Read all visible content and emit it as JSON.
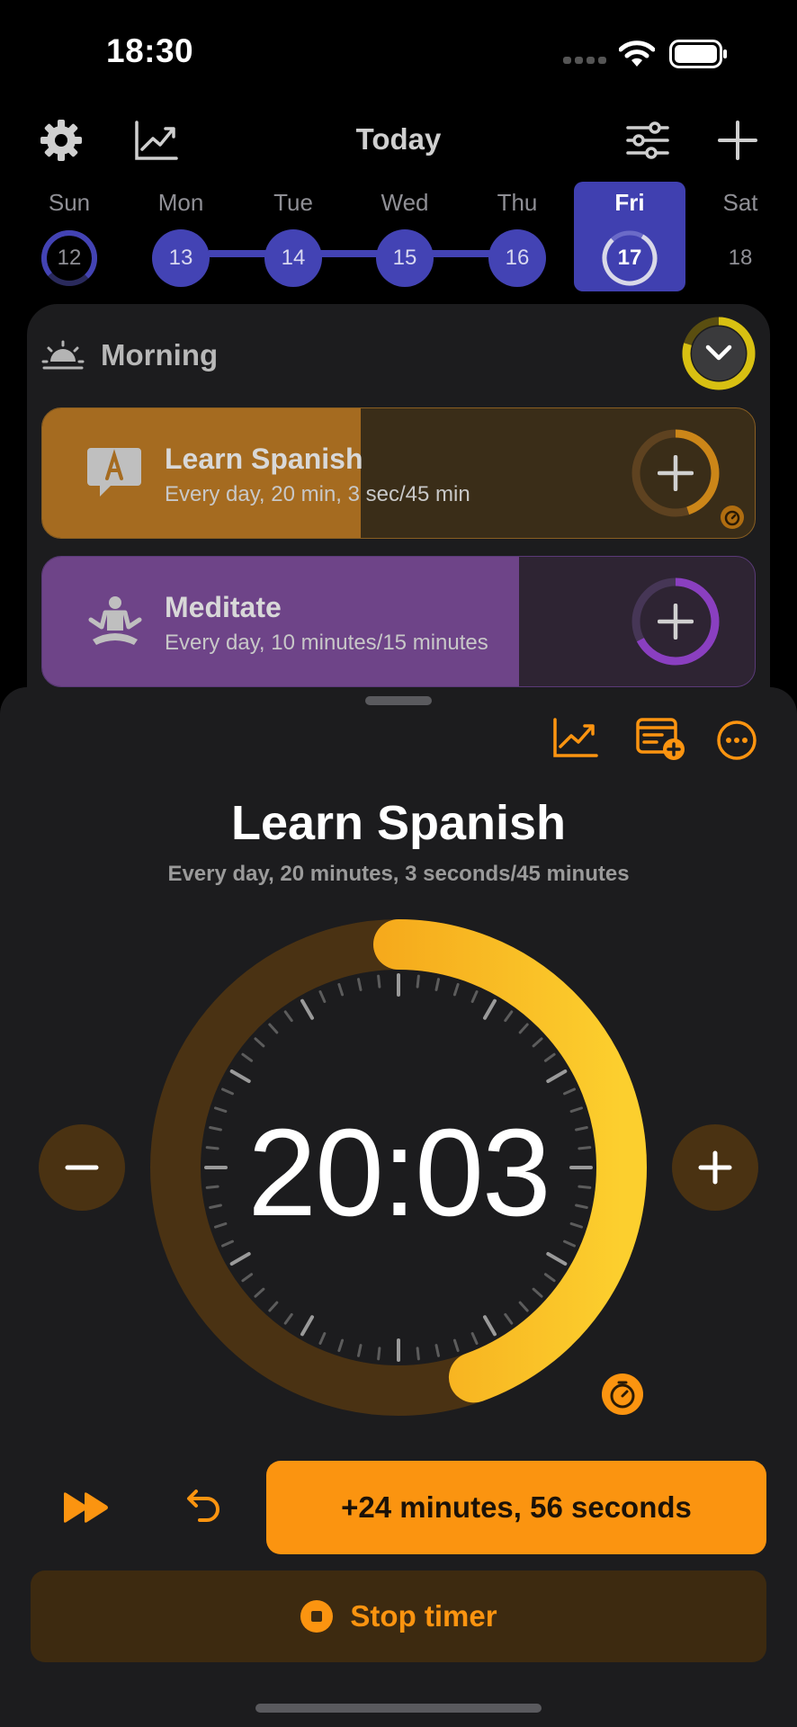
{
  "status_bar": {
    "time": "18:30"
  },
  "header": {
    "title": "Today"
  },
  "week": [
    {
      "name": "Sun",
      "date": "12",
      "state": "partial"
    },
    {
      "name": "Mon",
      "date": "13",
      "state": "done"
    },
    {
      "name": "Tue",
      "date": "14",
      "state": "done"
    },
    {
      "name": "Wed",
      "date": "15",
      "state": "done"
    },
    {
      "name": "Thu",
      "date": "16",
      "state": "done"
    },
    {
      "name": "Fri",
      "date": "17",
      "state": "selected"
    },
    {
      "name": "Sat",
      "date": "18",
      "state": "future"
    }
  ],
  "section": {
    "title": "Morning"
  },
  "habits": [
    {
      "title": "Learn Spanish",
      "subtitle": "Every day, 20 min, 3 sec/45 min",
      "icon": "chat-a-icon",
      "progress": 0.45,
      "color": "#fb9410"
    },
    {
      "title": "Meditate",
      "subtitle": "Every day, 10 minutes/15 minutes",
      "icon": "meditate-icon",
      "progress": 0.67,
      "color": "#8a46c8"
    }
  ],
  "sheet": {
    "title": "Learn Spanish",
    "subtitle": "Every day, 20 minutes, 3 seconds/45 minutes",
    "timer": "20:03",
    "progress": 0.445,
    "add_time_label": "+24 minutes, 56 seconds",
    "stop_label": "Stop timer"
  },
  "colors": {
    "accent": "#fb9410",
    "week_blue": "#4343b4",
    "background": "#000000",
    "sheet": "#1c1c1e"
  }
}
